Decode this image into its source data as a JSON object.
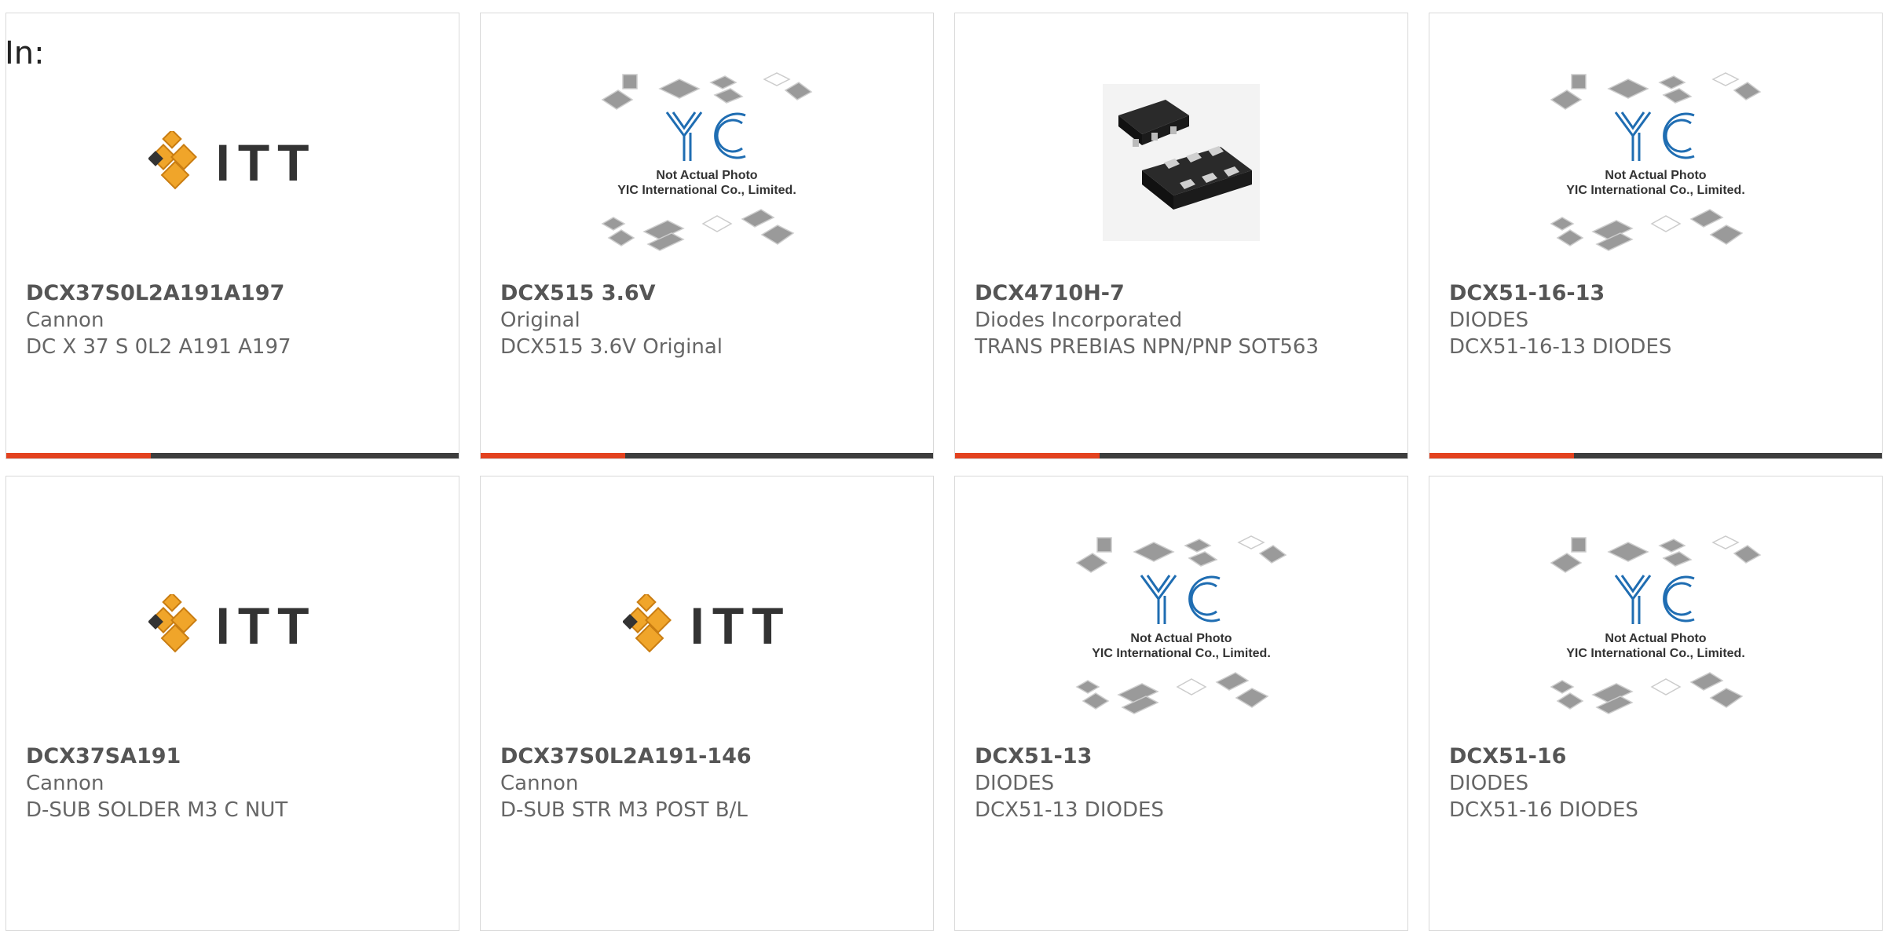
{
  "filter_label": "In:",
  "colors": {
    "accent": "#e3421f",
    "bar_dark": "#3d3d3d",
    "title": "#555555",
    "text": "#666666"
  },
  "products": [
    {
      "part": "DCX37S0L2A191A197",
      "maker": "Cannon",
      "desc": "DC X 37 S 0L2 A191 A197",
      "image": "itt-logo",
      "progress": 0.32
    },
    {
      "part": "DCX515 3.6V",
      "maker": "Original",
      "desc": "DCX515 3.6V Original",
      "image": "yic-placeholder",
      "progress": 0.32
    },
    {
      "part": "DCX4710H-7",
      "maker": "Diodes Incorporated",
      "desc": "TRANS PREBIAS NPN/PNP SOT563",
      "image": "chip-photo",
      "progress": 0.32
    },
    {
      "part": "DCX51-16-13",
      "maker": "DIODES",
      "desc": "DCX51-16-13 DIODES",
      "image": "yic-placeholder",
      "progress": 0.32
    },
    {
      "part": "DCX37SA191",
      "maker": "Cannon",
      "desc": "D-SUB SOLDER M3 C NUT",
      "image": "itt-logo"
    },
    {
      "part": "DCX37S0L2A191-146",
      "maker": "Cannon",
      "desc": "D-SUB STR M3 POST B/L",
      "image": "itt-logo"
    },
    {
      "part": "DCX51-13",
      "maker": "DIODES",
      "desc": "DCX51-13 DIODES",
      "image": "yic-placeholder"
    },
    {
      "part": "DCX51-16",
      "maker": "DIODES",
      "desc": "DCX51-16 DIODES",
      "image": "yic-placeholder"
    }
  ],
  "logos": {
    "itt_word": "ITT"
  },
  "placeholder": {
    "line1": "Not Actual Photo",
    "line2": "YIC International Co., Limited."
  }
}
